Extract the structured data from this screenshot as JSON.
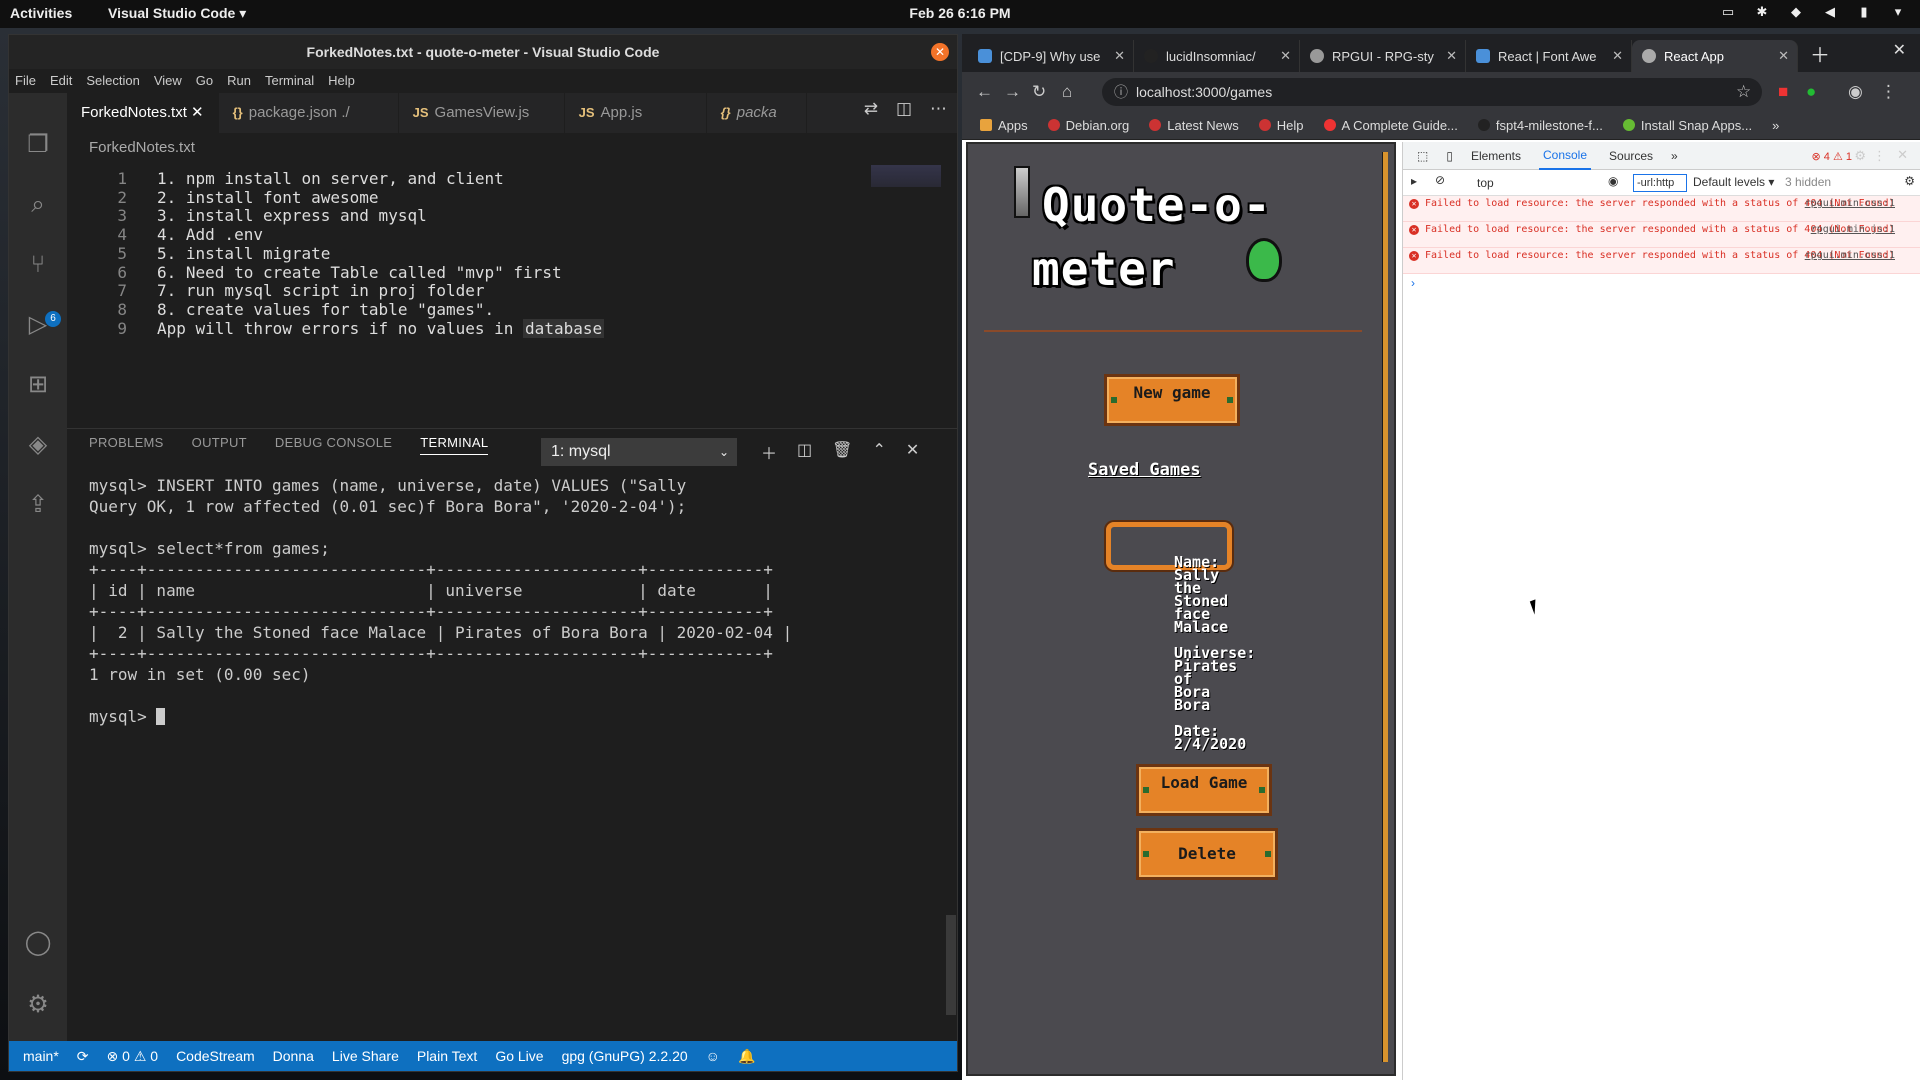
{
  "topbar": {
    "activities": "Activities",
    "app": "Visual Studio Code ▾",
    "clock": "Feb 26  6:16 PM"
  },
  "vscode": {
    "title": "ForkedNotes.txt - quote-o-meter - Visual Studio Code",
    "menu": [
      "File",
      "Edit",
      "Selection",
      "View",
      "Go",
      "Run",
      "Terminal",
      "Help"
    ],
    "tabs": [
      {
        "icon": "",
        "label": "ForkedNotes.txt"
      },
      {
        "icon": "{}",
        "label": "package.json ./"
      },
      {
        "icon": "JS",
        "label": "GamesView.js"
      },
      {
        "icon": "JS",
        "label": "App.js"
      },
      {
        "icon": "{}",
        "label": "packa"
      }
    ],
    "breadcrumb": "ForkedNotes.txt",
    "scm_badge": "6",
    "lines": [
      {
        "n": "1",
        "t": "1. npm install on server, and client"
      },
      {
        "n": "2",
        "t": "2. install font awesome"
      },
      {
        "n": "3",
        "t": "3. install express and mysql"
      },
      {
        "n": "4",
        "t": "4. Add .env"
      },
      {
        "n": "5",
        "t": "5. install migrate"
      },
      {
        "n": "6",
        "t": "6. Need to create Table called \"mvp\" first"
      },
      {
        "n": "7",
        "t": "7. run mysql script in proj folder"
      },
      {
        "n": "8",
        "t": "8. create values for table \"games\"."
      },
      {
        "n": "9",
        "t": "App will throw errors if no values in ",
        "hl": "database"
      }
    ],
    "panel_tabs": [
      "PROBLEMS",
      "OUTPUT",
      "DEBUG CONSOLE",
      "TERMINAL"
    ],
    "terminal_select": "1: mysql",
    "terminal": "mysql> INSERT INTO games (name, universe, date) VALUES (\"Sally\nQuery OK, 1 row affected (0.01 sec)f Bora Bora\", '2020-2-04');\n\nmysql> select*from games;\n+----+-----------------------------+---------------------+------------+\n| id | name                        | universe            | date       |\n+----+-----------------------------+---------------------+------------+\n|  2 | Sally the Stoned face Malace | Pirates of Bora Bora | 2020-02-04 |\n+----+-----------------------------+---------------------+------------+\n1 row in set (0.00 sec)\n\n",
    "terminal_prompt": "mysql> ",
    "status": [
      "main*",
      "⟳",
      "⊗ 0 ⚠ 0",
      "CodeStream",
      "Donna",
      "Live Share",
      "Plain Text",
      "Go Live",
      "gpg (GnuPG) 2.2.20"
    ]
  },
  "browser": {
    "tabs": [
      "[CDP-9] Why use",
      "lucidInsomniac/",
      "RPGUI - RPG-sty",
      "React | Font Awe",
      "React App"
    ],
    "url": "localhost:3000/games",
    "bookmarks": [
      "Apps",
      "Debian.org",
      "Latest News",
      "Help",
      "A Complete Guide...",
      "fspt4-milestone-f...",
      "Install Snap Apps..."
    ],
    "page": {
      "title_line1": "Quote-o-",
      "title_line2": "meter",
      "new_game": "New game",
      "saved_heading": "Saved Games",
      "game_text": "Name:\nSally\nthe\nStoned\nface\nMalace\n\nUniverse:\nPirates\nof\nBora\nBora\n\nDate:\n2/4/2020",
      "load_game": "Load Game",
      "delete": "Delete"
    },
    "devtools": {
      "tabs": [
        "Elements",
        "Console",
        "Sources"
      ],
      "errors": "⊗ 4  ⚠ 1",
      "context": "top",
      "filter": "-url:http",
      "levels": "Default levels ▾",
      "hidden": "3 hidden",
      "messages": [
        {
          "text": "Failed to load resource: the server responded with a status of 404 (Not Found)",
          "src": "rpgui.min.css:1"
        },
        {
          "text": "Failed to load resource: the server responded with a status of 404 (Not Found)",
          "src": "rpgui.min.js:1"
        },
        {
          "text": "Failed to load resource: the server responded with a status of 404 (Not Found)",
          "src": "rpgui.min.css:1"
        }
      ]
    }
  }
}
